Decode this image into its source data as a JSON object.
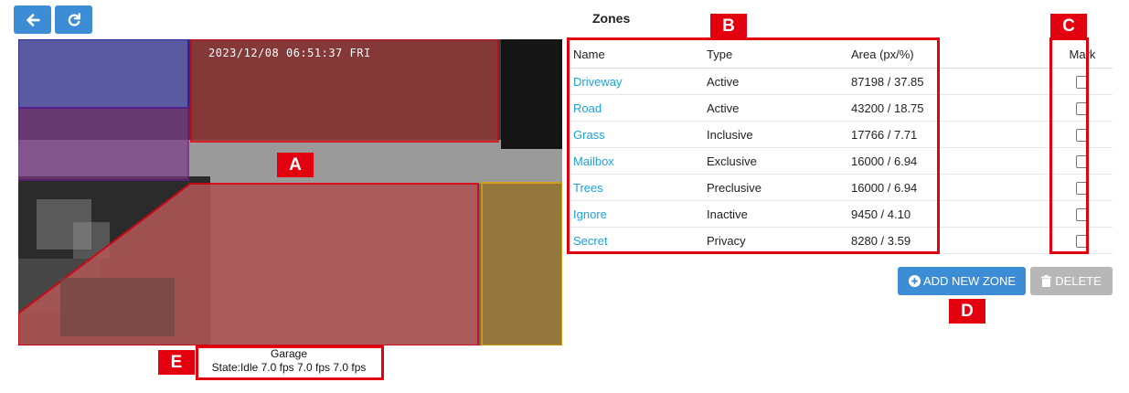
{
  "toolbar": {
    "back_icon": "arrow-left-icon",
    "refresh_icon": "refresh-icon"
  },
  "zones_title": "Zones",
  "camera": {
    "timestamp": "2023/12/08 06:51:37 FRI",
    "name": "Garage",
    "state": "State:Idle 7.0 fps 7.0 fps 7.0 fps"
  },
  "table": {
    "headers": [
      "Name",
      "Type",
      "Area (px/%)",
      "Mark"
    ],
    "rows": [
      {
        "name": "Driveway",
        "type": "Active",
        "area": "87198 / 37.85"
      },
      {
        "name": "Road",
        "type": "Active",
        "area": "43200 / 18.75"
      },
      {
        "name": "Grass",
        "type": "Inclusive",
        "area": "17766 / 7.71"
      },
      {
        "name": "Mailbox",
        "type": "Exclusive",
        "area": "16000 / 6.94"
      },
      {
        "name": "Trees",
        "type": "Preclusive",
        "area": "16000 / 6.94"
      },
      {
        "name": "Ignore",
        "type": "Inactive",
        "area": "9450 / 4.10"
      },
      {
        "name": "Secret",
        "type": "Privacy",
        "area": "8280 / 3.59"
      }
    ]
  },
  "buttons": {
    "add_label": "ADD NEW ZONE",
    "delete_label": "DELETE"
  },
  "markers": {
    "a": "A",
    "b": "B",
    "c": "C",
    "d": "D",
    "e": "E"
  },
  "colors": {
    "primary": "#3c8dd5",
    "link": "#1ba1e2",
    "marker": "#e3000f",
    "disabled": "#b7b7b7"
  }
}
